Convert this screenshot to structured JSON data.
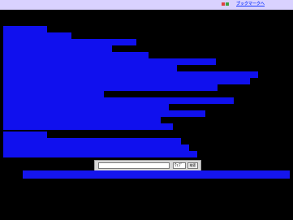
{
  "header": {
    "title": "",
    "bookmark_label": "ブックマークへ"
  },
  "nav": {
    "items": [
      "",
      "",
      "",
      "",
      "",
      "",
      "",
      "",
      "",
      "",
      "",
      "",
      "",
      "",
      "",
      "",
      "",
      "",
      "",
      ""
    ]
  },
  "search": {
    "placeholder": "",
    "select_value": "ｳｪﾌﾞ",
    "button_label": "検索"
  },
  "footer": {
    "link_text": ""
  },
  "colors": {
    "background": "#000000",
    "topbar": "#d9d2ff",
    "link_bar": "#1010ee",
    "link_text": "#2a40ff"
  },
  "icons": {
    "bookmark": "bookmark-icon"
  }
}
